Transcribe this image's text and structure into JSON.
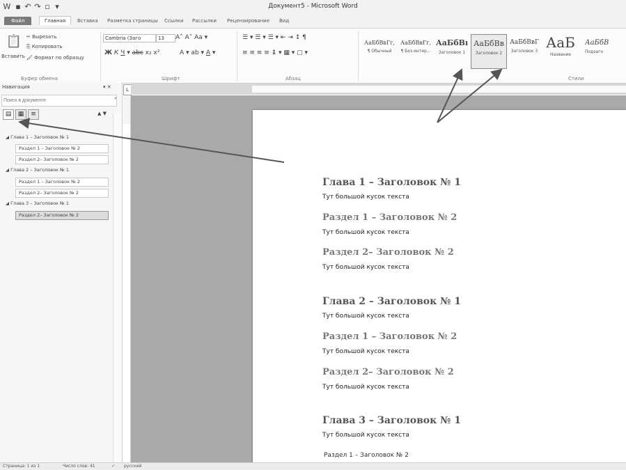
{
  "window": {
    "title": "Документ5 - Microsoft Word"
  },
  "tabs": [
    "Файл",
    "Главная",
    "Вставка",
    "Разметка страницы",
    "Ссылки",
    "Рассылки",
    "Рецензирование",
    "Вид"
  ],
  "ribbon": {
    "clipboard": {
      "paste": "Вставить",
      "cut": "Вырезать",
      "copy": "Копировать",
      "format_painter": "Формат по образцу",
      "label": "Буфер обмена"
    },
    "font": {
      "name": "Cambria (Заго",
      "size": "13",
      "label": "Шрифт"
    },
    "paragraph": {
      "label": "Абзац"
    },
    "styles": {
      "label": "Стили",
      "items": [
        {
          "sample": "АаБбВвГг,",
          "name": "¶ Обычный"
        },
        {
          "sample": "АаБбВвГг,",
          "name": "¶ Без интер..."
        },
        {
          "sample": "АаБбВı",
          "name": "Заголовок 1"
        },
        {
          "sample": "АаБбВв",
          "name": "Заголовок 2"
        },
        {
          "sample": "АаБбВвГ",
          "name": "Заголовок 3"
        },
        {
          "sample": "АаБ",
          "name": "Название"
        },
        {
          "sample": "АаБбВ",
          "name": "Подзаго"
        }
      ]
    }
  },
  "nav": {
    "title": "Навигация",
    "search_placeholder": "Поиск в документе",
    "items": [
      {
        "level": 1,
        "text": "Глава 1 – Заголовок № 1"
      },
      {
        "level": 2,
        "text": "Раздел 1 – Заголовок № 2"
      },
      {
        "level": 2,
        "text": "Раздел 2– Заголовок № 2"
      },
      {
        "level": 1,
        "text": "Глава 2 – Заголовок № 1"
      },
      {
        "level": 2,
        "text": "Раздел 1 – Заголовок № 2"
      },
      {
        "level": 2,
        "text": "Раздел 2– Заголовок № 2"
      },
      {
        "level": 1,
        "text": "Глава 3 – Заголовок № 1"
      },
      {
        "level": 2,
        "text": "Раздел 2– Заголовок № 2"
      }
    ]
  },
  "document": {
    "blocks": [
      {
        "style": "h1",
        "text": "Глава 1 – Заголовок № 1"
      },
      {
        "style": "body",
        "text": "Тут большой кусок текста"
      },
      {
        "style": "h2",
        "text": "Раздел 1 – Заголовок № 2"
      },
      {
        "style": "body",
        "text": "Тут большой кусок текста"
      },
      {
        "style": "h2",
        "text": "Раздел 2– Заголовок № 2"
      },
      {
        "style": "body",
        "text": "Тут большой кусок текста"
      },
      {
        "style": "h1",
        "text": "Глава 2 – Заголовок № 1"
      },
      {
        "style": "body",
        "text": "Тут большой кусок текста"
      },
      {
        "style": "h2",
        "text": "Раздел 1 – Заголовок № 2"
      },
      {
        "style": "body",
        "text": "Тут большой кусок текста"
      },
      {
        "style": "h2",
        "text": "Раздел 2– Заголовок № 2"
      },
      {
        "style": "body",
        "text": "Тут большой кусок текста"
      },
      {
        "style": "h1",
        "text": "Глава 3 – Заголовок № 1"
      },
      {
        "style": "body",
        "text": "Тут большой кусок текста"
      },
      {
        "style": "plain",
        "text": "Раздел 1 – Заголовок № 2"
      }
    ]
  },
  "statusbar": {
    "page": "Страница: 1 из 1",
    "words": "Число слов: 41",
    "language": "русский"
  }
}
